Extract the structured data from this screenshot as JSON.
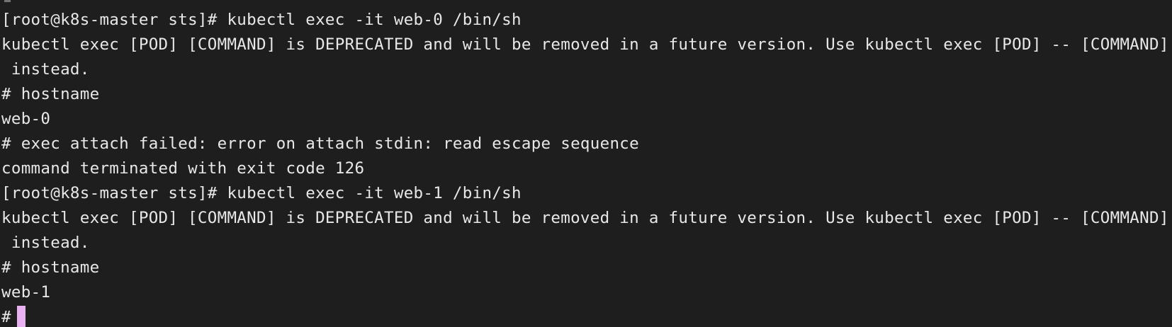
{
  "terminal": {
    "lines": [
      "[root@k8s-master sts]# kubectl exec -it web-0 /bin/sh",
      "kubectl exec [POD] [COMMAND] is DEPRECATED and will be removed in a future version. Use kubectl exec [POD] -- [COMMAND]",
      " instead.",
      "# hostname",
      "web-0",
      "# exec attach failed: error on attach stdin: read escape sequence",
      "command terminated with exit code 126",
      "[root@k8s-master sts]# kubectl exec -it web-1 /bin/sh",
      "kubectl exec [POD] [COMMAND] is DEPRECATED and will be removed in a future version. Use kubectl exec [POD] -- [COMMAND]",
      " instead.",
      "# hostname",
      "web-1"
    ],
    "current_prompt": "#",
    "cursor_color": "#e7b3ef",
    "background_color": "#1e1e1e",
    "text_color": "#e8e8e8"
  }
}
